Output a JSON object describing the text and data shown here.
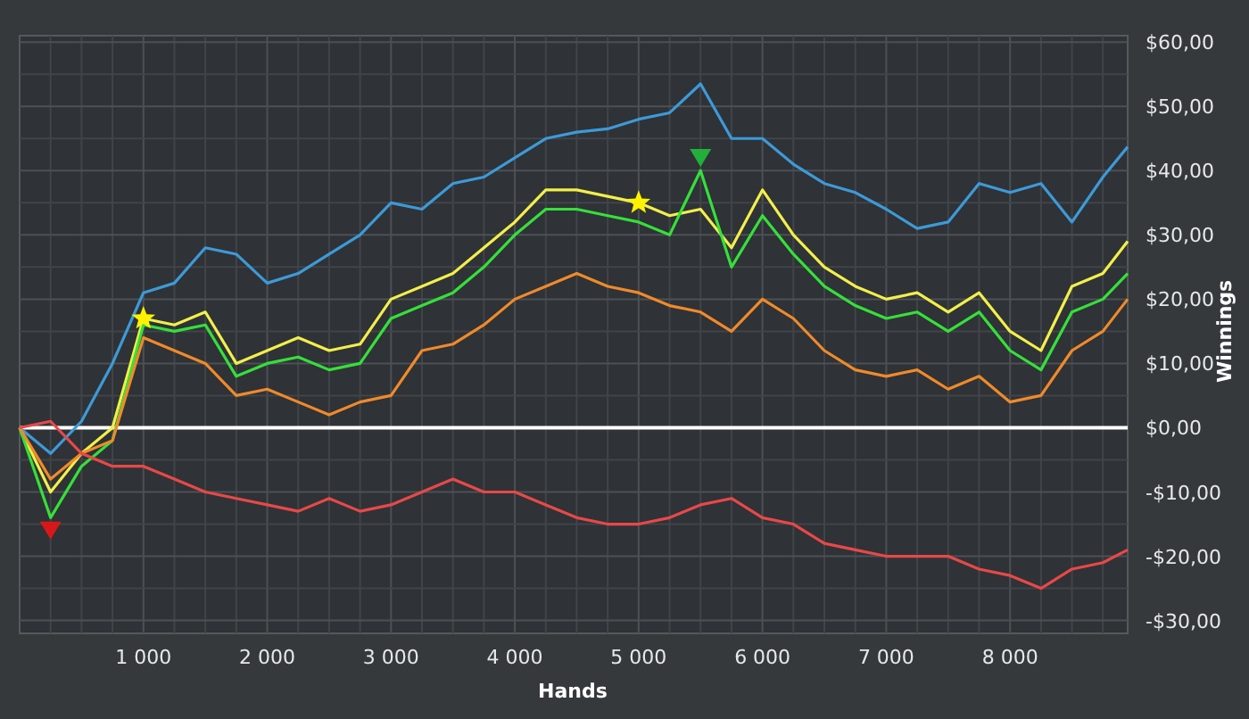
{
  "chart": {
    "chart_data": {
      "type": "line",
      "xlabel": "Hands",
      "ylabel": "Winnings",
      "x": [
        0,
        250,
        500,
        750,
        1000,
        1250,
        1500,
        1750,
        2000,
        2250,
        2500,
        2750,
        3000,
        3250,
        3500,
        3750,
        4000,
        4250,
        4500,
        4750,
        5000,
        5250,
        5500,
        5750,
        6000,
        6250,
        6500,
        6750,
        7000,
        7250,
        7500,
        7750,
        8000,
        8250,
        8500,
        8750,
        8950
      ],
      "series": [
        {
          "color": "#3d9ad8",
          "values": [
            0,
            -4,
            1,
            10,
            21,
            22.5,
            28,
            27,
            22.5,
            24,
            27,
            30,
            35,
            34,
            38,
            39,
            42,
            45,
            46,
            46.5,
            48,
            49,
            53.5,
            45,
            45,
            41,
            38,
            36.6,
            34,
            31,
            32,
            38,
            36.6,
            38,
            32,
            39,
            43.7
          ]
        },
        {
          "color": "#f2ef4a",
          "values": [
            0,
            -10,
            -4,
            0,
            17,
            16,
            18,
            10,
            12,
            14,
            12,
            13,
            20,
            22,
            24,
            28,
            32,
            37,
            37,
            36,
            35,
            33,
            34,
            28,
            37,
            30,
            25,
            22,
            20,
            21,
            18,
            21,
            15,
            12,
            22,
            24,
            29
          ]
        },
        {
          "color": "#35e03a",
          "values": [
            0,
            -14,
            -6,
            -2,
            16,
            15,
            16,
            8,
            10,
            11,
            9,
            10,
            17,
            19,
            21,
            25,
            30,
            34,
            34,
            33,
            32,
            30,
            40,
            25,
            33,
            27,
            22,
            19,
            17,
            18,
            15,
            18,
            12,
            9,
            18,
            20,
            24
          ]
        },
        {
          "color": "#f08a2a",
          "values": [
            0,
            -8,
            -4,
            -2,
            14,
            12,
            10,
            5,
            6,
            4,
            2,
            4,
            5,
            12,
            13,
            16,
            20,
            22,
            24,
            22,
            21,
            19,
            18,
            15,
            20,
            17,
            12,
            9,
            8,
            9,
            6,
            8,
            4,
            5,
            12,
            15,
            20
          ]
        },
        {
          "color": "#e84848",
          "values": [
            0,
            1,
            -4,
            -6,
            -6,
            -8,
            -10,
            -11,
            -12,
            -13,
            -11,
            -13,
            -12,
            -10,
            -8,
            -10,
            -10,
            -12,
            -14,
            -15,
            -15,
            -14,
            -12,
            -11,
            -14,
            -15,
            -18,
            -19,
            -20,
            -20,
            -20,
            -22,
            -23,
            -25,
            -22,
            -21,
            -19
          ]
        },
        {
          "color": "#fff200",
          "marker": "star",
          "values": [
            null,
            null,
            null,
            null,
            17,
            null,
            null,
            null,
            null,
            null,
            null,
            null,
            null,
            null,
            null,
            null,
            null,
            null,
            null,
            null,
            null,
            null,
            null,
            null,
            null,
            null,
            null,
            null,
            null,
            null,
            null,
            null,
            null,
            null,
            null,
            null,
            null
          ]
        },
        {
          "color": "#fff200",
          "marker": "star",
          "values": [
            null,
            null,
            null,
            null,
            null,
            null,
            null,
            null,
            null,
            null,
            null,
            null,
            null,
            null,
            null,
            null,
            null,
            null,
            null,
            null,
            35,
            null,
            null,
            null,
            null,
            null,
            null,
            null,
            null,
            null,
            null,
            null,
            null,
            null,
            null,
            null,
            null
          ]
        },
        {
          "color": "#22b03a",
          "marker": "triangle",
          "values": [
            null,
            null,
            null,
            null,
            null,
            null,
            null,
            null,
            null,
            null,
            null,
            null,
            null,
            null,
            null,
            null,
            null,
            null,
            null,
            null,
            null,
            null,
            42,
            null,
            null,
            null,
            null,
            null,
            null,
            null,
            null,
            null,
            null,
            null,
            null,
            null,
            null
          ]
        },
        {
          "color": "#d81818",
          "marker": "triangle",
          "values": [
            null,
            -16,
            null,
            null,
            null,
            null,
            null,
            null,
            null,
            null,
            null,
            null,
            null,
            null,
            null,
            null,
            null,
            null,
            null,
            null,
            null,
            null,
            null,
            null,
            null,
            null,
            null,
            null,
            null,
            null,
            null,
            null,
            null,
            null,
            null,
            null,
            null
          ]
        }
      ],
      "grid": true,
      "xlim": [
        0,
        8950
      ],
      "ylim": [
        -32,
        61
      ],
      "xticks": [
        {
          "value": 1000,
          "label": "1 000"
        },
        {
          "value": 2000,
          "label": "2 000"
        },
        {
          "value": 3000,
          "label": "3 000"
        },
        {
          "value": 4000,
          "label": "4 000"
        },
        {
          "value": 5000,
          "label": "5 000"
        },
        {
          "value": 6000,
          "label": "6 000"
        },
        {
          "value": 7000,
          "label": "7 000"
        },
        {
          "value": 8000,
          "label": "8 000"
        }
      ],
      "yticks": [
        {
          "value": 60,
          "label": "$60,00"
        },
        {
          "value": 50,
          "label": "$50,00"
        },
        {
          "value": 40,
          "label": "$40,00"
        },
        {
          "value": 30,
          "label": "$30,00"
        },
        {
          "value": 20,
          "label": "$20,00"
        },
        {
          "value": 10,
          "label": "$10,00"
        },
        {
          "value": 0,
          "label": "$0,00"
        },
        {
          "value": -10,
          "label": "-$10,00"
        },
        {
          "value": -20,
          "label": "-$20,00"
        },
        {
          "value": -30,
          "label": "-$30,00"
        }
      ]
    }
  }
}
